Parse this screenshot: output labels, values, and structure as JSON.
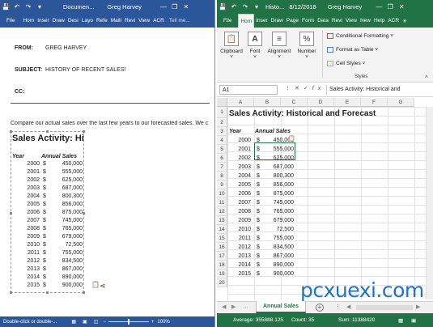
{
  "word": {
    "title": "Documen...",
    "user": "Greg Harvey",
    "tabs": [
      "File",
      "Hom",
      "Inser",
      "Draw",
      "Desi",
      "Layo",
      "Refe",
      "Maili",
      "Revi",
      "View",
      "ACR",
      "Tell me..."
    ],
    "header": {
      "from_label": "FROM:",
      "from_value": "GREG HARVEY",
      "subject_label": "SUBJECT:",
      "subject_value": "HISTORY OF RECENT SALES!",
      "cc_label": "CC:"
    },
    "paragraph": "Compare our actual sales over the last few years to our forecasted sales. We c",
    "embedded": {
      "title": "Sales Activity: Hist",
      "year_header": "Year",
      "sales_header": "Annual Sales"
    },
    "status": "Double-click or double-...",
    "zoom": "100%"
  },
  "excel": {
    "title": "Histo...",
    "date": "8/12/2018",
    "user": "Greg Harvey",
    "tabs": [
      "File",
      "Hom",
      "Inser",
      "Draw",
      "Page",
      "Form",
      "Data",
      "Revi",
      "View",
      "New",
      "Help",
      "ACR"
    ],
    "ribbon": {
      "clipboard": "Clipboard",
      "font": "Font",
      "alignment": "Alignment",
      "number": "Number",
      "conditional": "Conditional Formatting",
      "format_table": "Format as Table",
      "cell_styles": "Cell Styles",
      "styles": "Styles"
    },
    "name_box": "A1",
    "formula": "Sales Activity: Historical and",
    "columns": [
      "A",
      "B",
      "C",
      "D",
      "E",
      "F",
      "G"
    ],
    "rows": [
      "1",
      "2",
      "3",
      "4",
      "5",
      "6",
      "7",
      "8",
      "9",
      "10",
      "11",
      "12",
      "13",
      "14",
      "15",
      "16",
      "17",
      "18",
      "19",
      "20"
    ],
    "sheet_title": "Sales Activity: Historical and Forecast",
    "year_header": "Year",
    "sales_header": "Annual Sales",
    "sheet_tab": "Annual Sales",
    "status": {
      "average": "Average: 355888.125",
      "count": "Count: 35",
      "sum": "Sum: 11388420"
    }
  },
  "sales": [
    {
      "year": "2000",
      "dollar": "$",
      "value": "450,000"
    },
    {
      "year": "2001",
      "dollar": "$",
      "value": "555,000"
    },
    {
      "year": "2002",
      "dollar": "$",
      "value": "625,000"
    },
    {
      "year": "2003",
      "dollar": "$",
      "value": "687,000"
    },
    {
      "year": "2004",
      "dollar": "$",
      "value": "800,300"
    },
    {
      "year": "2005",
      "dollar": "$",
      "value": "856,000"
    },
    {
      "year": "2006",
      "dollar": "$",
      "value": "875,000"
    },
    {
      "year": "2007",
      "dollar": "$",
      "value": "745,000"
    },
    {
      "year": "2008",
      "dollar": "$",
      "value": "765,000"
    },
    {
      "year": "2009",
      "dollar": "$",
      "value": "679,000"
    },
    {
      "year": "2010",
      "dollar": "$",
      "value": "72,500"
    },
    {
      "year": "2011",
      "dollar": "$",
      "value": "755,000"
    },
    {
      "year": "2012",
      "dollar": "$",
      "value": "834,500"
    },
    {
      "year": "2013",
      "dollar": "$",
      "value": "867,000"
    },
    {
      "year": "2014",
      "dollar": "$",
      "value": "890,000"
    },
    {
      "year": "2015",
      "dollar": "$",
      "value": "900,000"
    }
  ],
  "watermark": "pcxuexi.com"
}
